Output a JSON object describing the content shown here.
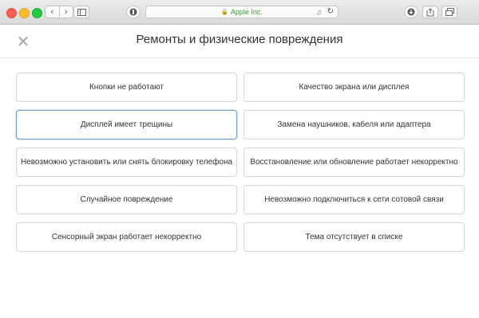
{
  "browser": {
    "address_text": "Apple Inc."
  },
  "header": {
    "title": "Ремонты и физические повреждения"
  },
  "options": [
    {
      "label": "Кнопки не работают"
    },
    {
      "label": "Качество экрана или дисплея"
    },
    {
      "label": "Дисплей имеет трещины"
    },
    {
      "label": "Замена наушников, кабеля или адаптера"
    },
    {
      "label": "Невозможно установить или снять блокировку телефона"
    },
    {
      "label": "Восстановление или обновление работает некорректно"
    },
    {
      "label": "Случайное повреждение"
    },
    {
      "label": "Невозможно подключиться к сети сотовой связи"
    },
    {
      "label": "Сенсорный экран работает некорректно"
    },
    {
      "label": "Тема отсутствует в списке"
    }
  ],
  "selected_option_index": 2,
  "colors": {
    "address_secure": "#3a9a3a",
    "selected_border": "#6f9fd0"
  }
}
